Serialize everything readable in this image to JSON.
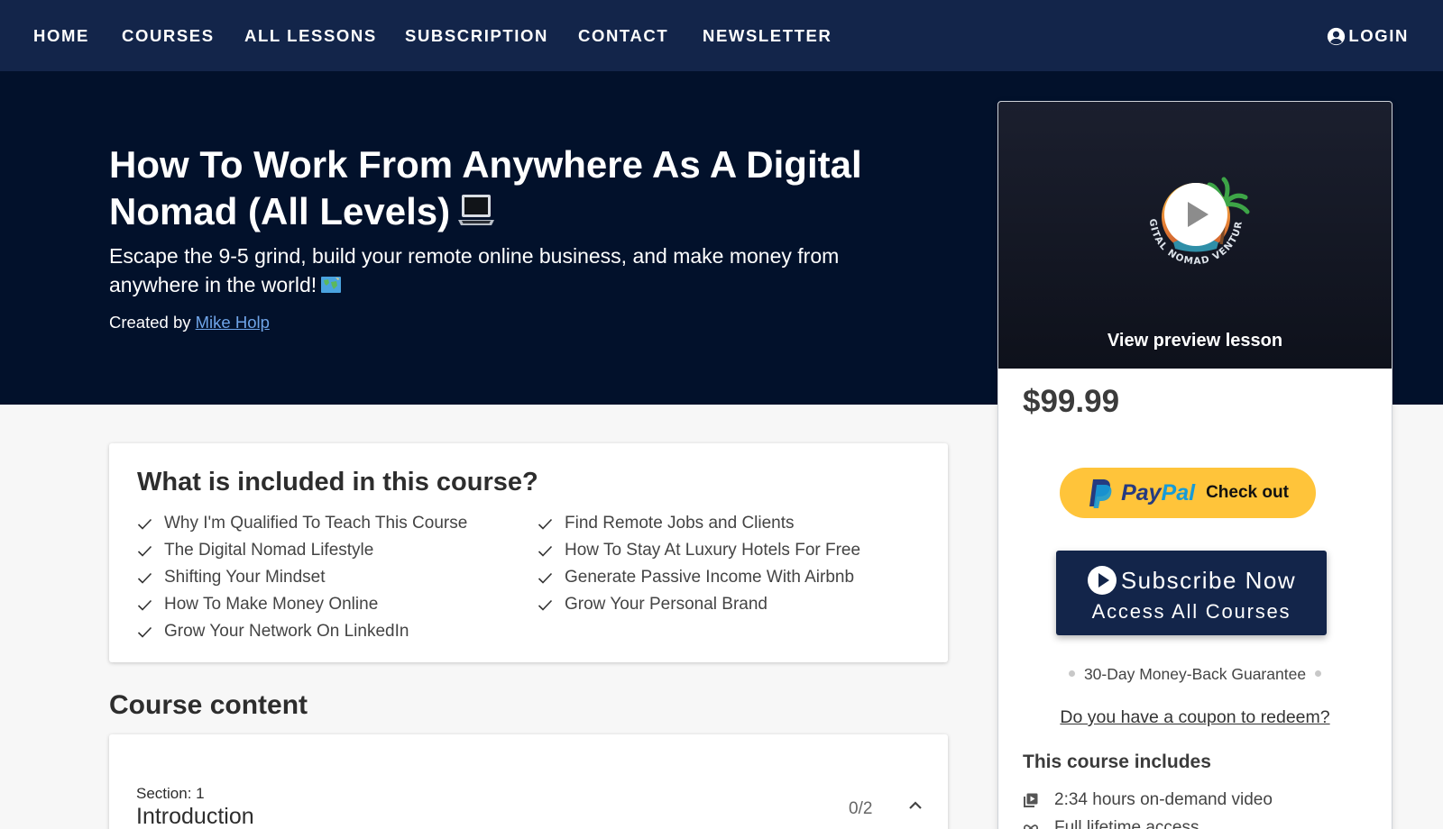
{
  "nav": {
    "items": [
      "HOME",
      "COURSES",
      "ALL LESSONS",
      "SUBSCRIPTION",
      "CONTACT",
      "NEWSLETTER"
    ],
    "login": "LOGIN",
    "login_icon": "user-circle-icon"
  },
  "hero": {
    "title": "How To Work From Anywhere As A Digital Nomad (All Levels)",
    "title_emoji": "laptop-icon",
    "subtitle": "Escape the 9-5 grind, build your remote online business, and make money from anywhere in the world!",
    "subtitle_emoji": "world-map-icon",
    "created_by_label": "Created by",
    "author": "Mike Holp"
  },
  "included": {
    "title": "What is included in this course?",
    "col1": [
      "Why I'm Qualified To Teach This Course",
      "The Digital Nomad Lifestyle",
      "Shifting Your Mindset",
      "How To Make Money Online",
      "Grow Your Network On LinkedIn"
    ],
    "col2": [
      "Find Remote Jobs and Clients",
      "How To Stay At Luxury Hotels For Free",
      "Generate Passive Income With Airbnb",
      "Grow Your Personal Brand"
    ]
  },
  "content": {
    "title": "Course content",
    "section_label": "Section: 1",
    "section_name": "Introduction",
    "section_count": "0/2"
  },
  "sidebar": {
    "logo_text": "DIGITAL NOMAD VENTURES",
    "preview_label": "View preview lesson",
    "price": "$99.99",
    "paypal": {
      "pay": "Pay",
      "pal": "Pal",
      "checkout": "Check out"
    },
    "subscribe_line1": "Subscribe Now",
    "subscribe_line2": "Access All Courses",
    "guarantee": "30-Day Money-Back Guarantee",
    "coupon": "Do you have a coupon to redeem?",
    "includes_title": "This course includes",
    "includes_items": [
      "2:34 hours on-demand video",
      "Full lifetime access"
    ]
  },
  "colors": {
    "nav_bg": "#13254a",
    "hero_bg": "#02112b",
    "author_link": "#6fa4e8",
    "paypal_yellow": "#ffc43a",
    "subscribe_bg": "#13254a"
  }
}
